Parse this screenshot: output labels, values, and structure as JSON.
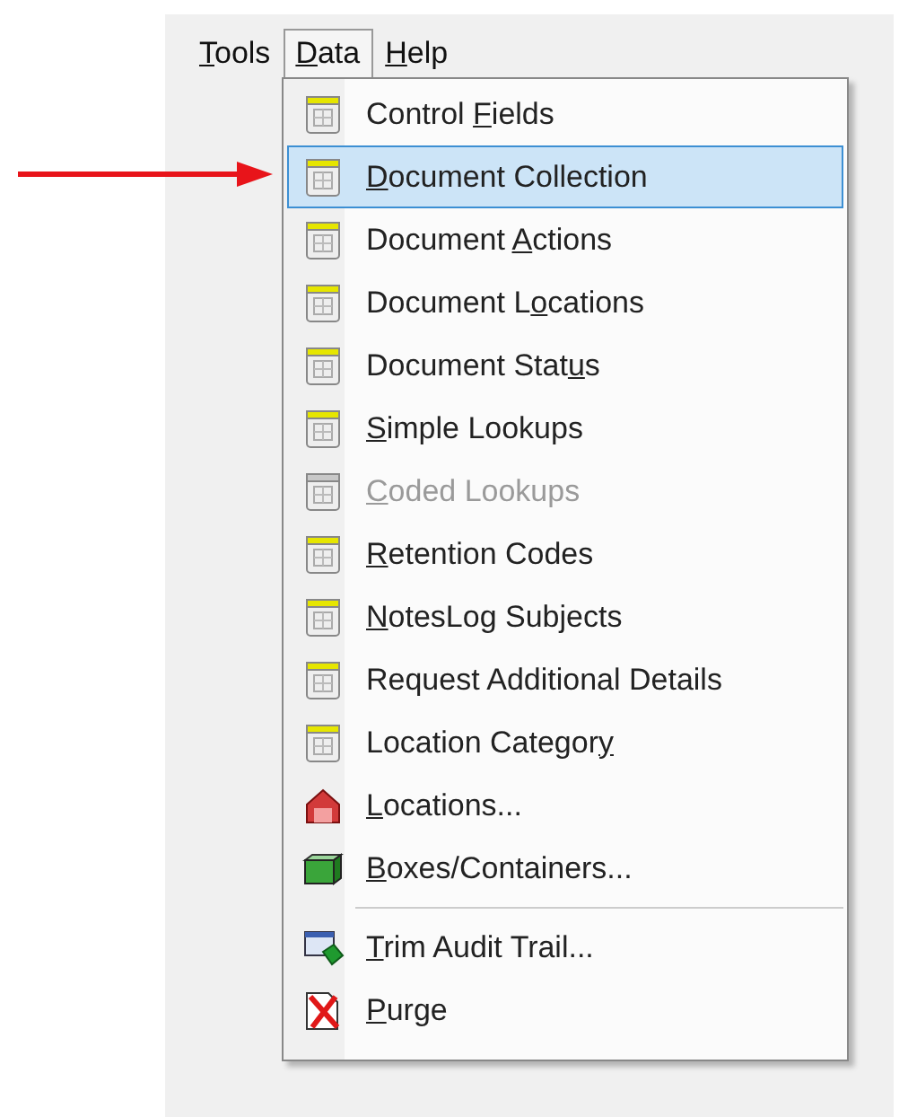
{
  "menu_bar": [
    {
      "key": "T",
      "after": "ools",
      "selected": false
    },
    {
      "key": "D",
      "after": "ata",
      "selected": true
    },
    {
      "key": "H",
      "after": "elp",
      "selected": false
    }
  ],
  "menu": {
    "items": [
      {
        "kind": "table",
        "before": "Control ",
        "key": "F",
        "after": "ields",
        "selected": false,
        "disabled": false
      },
      {
        "kind": "table",
        "key": "D",
        "after": "ocument Collection",
        "selected": true,
        "disabled": false
      },
      {
        "kind": "table",
        "before": "Document ",
        "key": "A",
        "after": "ctions",
        "selected": false,
        "disabled": false
      },
      {
        "kind": "table",
        "before": "Document L",
        "key": "o",
        "after": "cations",
        "selected": false,
        "disabled": false
      },
      {
        "kind": "table",
        "before": "Document Stat",
        "key": "u",
        "after": "s",
        "selected": false,
        "disabled": false
      },
      {
        "kind": "table",
        "key": "S",
        "after": "imple Lookups",
        "selected": false,
        "disabled": false
      },
      {
        "kind": "table",
        "key": "C",
        "after": "oded Lookups",
        "selected": false,
        "disabled": true
      },
      {
        "kind": "table",
        "key": "R",
        "after": "etention Codes",
        "selected": false,
        "disabled": false
      },
      {
        "kind": "table",
        "key": "N",
        "after": "otesLog Subjects",
        "selected": false,
        "disabled": false
      },
      {
        "kind": "table",
        "before": "Request Additional Details",
        "selected": false,
        "disabled": false
      },
      {
        "kind": "table",
        "before": "Location Categor",
        "key": "y",
        "selected": false,
        "disabled": false
      },
      {
        "kind": "house",
        "key": "L",
        "after": "ocations...",
        "selected": false,
        "disabled": false
      },
      {
        "kind": "box",
        "key": "B",
        "after": "oxes/Containers...",
        "selected": false,
        "disabled": false
      },
      {
        "kind": "separator"
      },
      {
        "kind": "audit",
        "key": "T",
        "after": "rim Audit Trail...",
        "selected": false,
        "disabled": false
      },
      {
        "kind": "purge",
        "key": "P",
        "after": "urge",
        "selected": false,
        "disabled": false
      }
    ]
  }
}
